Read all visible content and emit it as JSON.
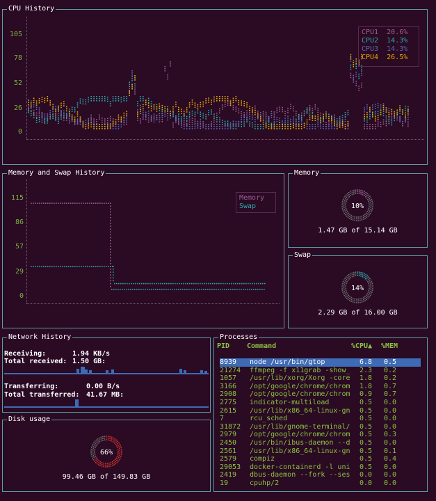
{
  "cpu": {
    "title": "CPU History",
    "ticks": [
      "105",
      "78",
      "52",
      "26",
      "0"
    ],
    "legend": [
      {
        "label": "CPU1",
        "value": "20.6%",
        "color": "#9a5e8e"
      },
      {
        "label": "CPU2",
        "value": "14.3%",
        "color": "#2ca7a7"
      },
      {
        "label": "CPU3",
        "value": "14.3%",
        "color": "#5868b0"
      },
      {
        "label": "CPU4",
        "value": "26.5%",
        "color": "#e0a800"
      }
    ]
  },
  "memhist": {
    "title": "Memory and Swap History",
    "ticks": [
      "115",
      "86",
      "57",
      "29",
      "0"
    ],
    "legend": [
      {
        "label": "Memory",
        "color": "#9a5e8e"
      },
      {
        "label": "Swap",
        "color": "#2ca7a7"
      }
    ]
  },
  "memory": {
    "title": "Memory",
    "percent": "10%",
    "detail": "1.47 GB of 15.14 GB",
    "fraction": 0.1
  },
  "swap": {
    "title": "Swap",
    "percent": "14%",
    "detail": "2.29 GB of 16.00 GB",
    "fraction": 0.14
  },
  "network": {
    "title": "Network History",
    "receiving_label": "Receiving:",
    "receiving_value": "1.94 KB/s",
    "total_received_label": "Total received:",
    "total_received_value": "1.50 GB:",
    "transferring_label": "Transferring:",
    "transferring_value": "0.00 B/s",
    "total_transferred_label": "Total transferred:",
    "total_transferred_value": "41.67 MB:"
  },
  "disk": {
    "title": "Disk usage",
    "percent": "66%",
    "detail": "99.46 GB of 149.83 GB",
    "fraction": 0.66
  },
  "processes": {
    "title": "Processes",
    "headers": {
      "pid": "PID",
      "command": "Command",
      "cpu": "%CPU▲",
      "mem": "%MEM"
    },
    "rows": [
      {
        "pid": "8939",
        "command": "node /usr/bin/gtop",
        "cpu": "6.8",
        "mem": "0.5"
      },
      {
        "pid": "21274",
        "command": "ffmpeg -f x11grab -show_",
        "cpu": "2.3",
        "mem": "0.2"
      },
      {
        "pid": "1057",
        "command": "/usr/lib/xorg/Xorg -core",
        "cpu": "1.8",
        "mem": "0.2"
      },
      {
        "pid": "3166",
        "command": "/opt/google/chrome/chrom",
        "cpu": "1.8",
        "mem": "0.7"
      },
      {
        "pid": "2908",
        "command": "/opt/google/chrome/chrom",
        "cpu": "0.9",
        "mem": "0.7"
      },
      {
        "pid": "2775",
        "command": "indicator-multiload",
        "cpu": "0.5",
        "mem": "0.0"
      },
      {
        "pid": "2615",
        "command": "/usr/lib/x86_64-linux-gn",
        "cpu": "0.5",
        "mem": "0.0"
      },
      {
        "pid": "7",
        "command": "rcu_sched",
        "cpu": "0.5",
        "mem": "0.0"
      },
      {
        "pid": "31872",
        "command": "/usr/lib/gnome-terminal/",
        "cpu": "0.5",
        "mem": "0.0"
      },
      {
        "pid": "2979",
        "command": "/opt/google/chrome/chrom",
        "cpu": "0.5",
        "mem": "0.3"
      },
      {
        "pid": "2450",
        "command": "/usr/bin/ibus-daemon --d",
        "cpu": "0.5",
        "mem": "0.0"
      },
      {
        "pid": "2561",
        "command": "/usr/lib/x86_64-linux-gn",
        "cpu": "0.5",
        "mem": "0.1"
      },
      {
        "pid": "2579",
        "command": "compiz",
        "cpu": "0.5",
        "mem": "0.4"
      },
      {
        "pid": "29053",
        "command": "docker-containerd -l uni",
        "cpu": "0.5",
        "mem": "0.0"
      },
      {
        "pid": "2419",
        "command": "dbus-daemon --fork --ses",
        "cpu": "0.0",
        "mem": "0.0"
      },
      {
        "pid": "19",
        "command": "cpuhp/2",
        "cpu": "0.0",
        "mem": "0.0"
      }
    ]
  }
}
